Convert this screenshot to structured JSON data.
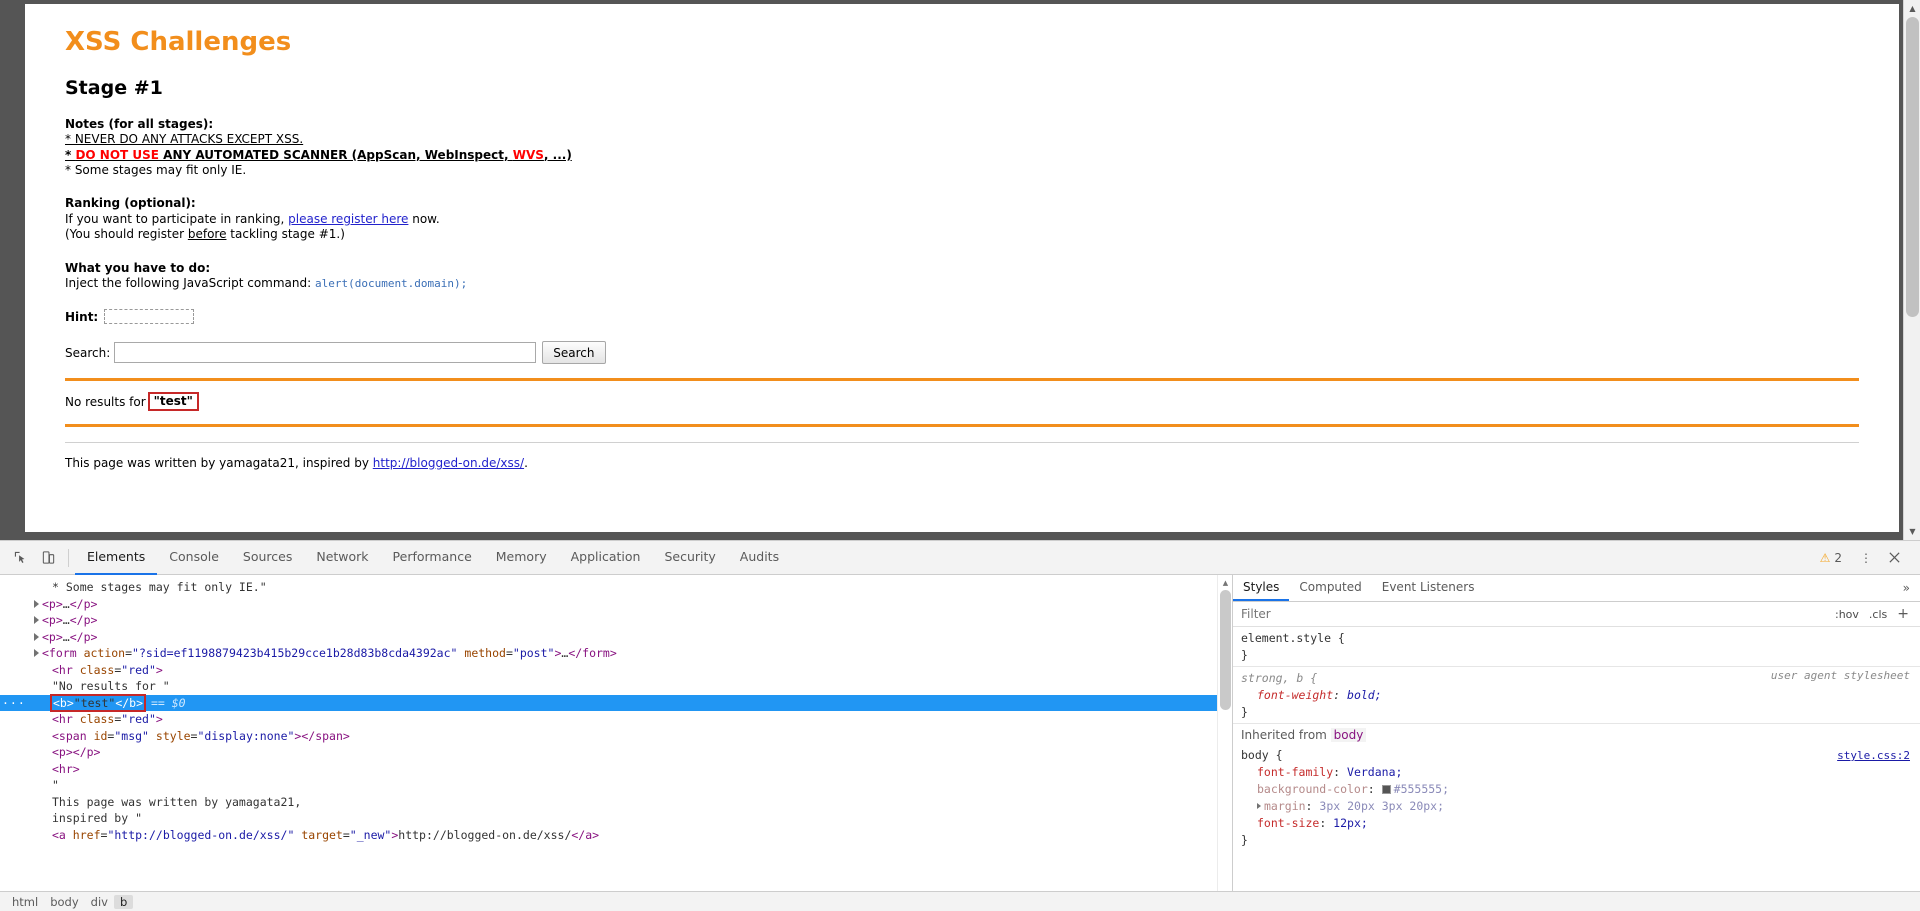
{
  "page": {
    "title": "XSS Challenges",
    "stage": "Stage #1",
    "notes_heading": "Notes (for all stages):",
    "note1": "* NEVER DO ANY ATTACKS EXCEPT XSS.",
    "note2_star": "* ",
    "note2_red": "DO NOT USE",
    "note2_rest": " ANY AUTOMATED SCANNER (AppScan, WebInspect, ",
    "note2_red2": "WVS",
    "note2_tail": ", ...)",
    "note3": "* Some stages may fit only IE.",
    "ranking_heading": "Ranking (optional):",
    "ranking_line1_pre": "If you want to participate in ranking, ",
    "ranking_link": "please register here",
    "ranking_line1_post": " now.",
    "ranking_line2_pre": "(You should register ",
    "ranking_line2_em": "before",
    "ranking_line2_post": " tackling stage #1.)",
    "todo_heading": "What you have to do:",
    "todo_text": "Inject the following JavaScript command: ",
    "todo_code": "alert(document.domain);",
    "hint_label": "Hint:",
    "hint_value": "",
    "search_label": "Search:",
    "search_value": "",
    "search_placeholder": "",
    "search_button": "Search",
    "result_prefix": "No results for ",
    "result_term": "\"test\"",
    "footer_pre": "This page was written by yamagata21, inspired by ",
    "footer_link": "http://blogged-on.de/xss/",
    "footer_post": "."
  },
  "devtools": {
    "tabs": [
      {
        "label": "Elements",
        "active": true
      },
      {
        "label": "Console",
        "active": false
      },
      {
        "label": "Sources",
        "active": false
      },
      {
        "label": "Network",
        "active": false
      },
      {
        "label": "Performance",
        "active": false
      },
      {
        "label": "Memory",
        "active": false
      },
      {
        "label": "Application",
        "active": false
      },
      {
        "label": "Security",
        "active": false
      },
      {
        "label": "Audits",
        "active": false
      }
    ],
    "warning_count": "2",
    "dom_lines": [
      {
        "id": "l0",
        "indent": 3,
        "twisty": false,
        "selected": false,
        "html": "<span class=\"txtc\">* Some stages may fit only IE.\"</span>"
      },
      {
        "id": "l1",
        "indent": 2,
        "twisty": true,
        "selected": false,
        "html": "<span class=\"tagc\">&lt;p&gt;</span><span class=\"punct\">…</span><span class=\"tagc\">&lt;/p&gt;</span>"
      },
      {
        "id": "l2",
        "indent": 2,
        "twisty": true,
        "selected": false,
        "html": "<span class=\"tagc\">&lt;p&gt;</span><span class=\"punct\">…</span><span class=\"tagc\">&lt;/p&gt;</span>"
      },
      {
        "id": "l3",
        "indent": 2,
        "twisty": true,
        "selected": false,
        "html": "<span class=\"tagc\">&lt;p&gt;</span><span class=\"punct\">…</span><span class=\"tagc\">&lt;/p&gt;</span>"
      },
      {
        "id": "l4",
        "indent": 2,
        "twisty": true,
        "selected": false,
        "html": "<span class=\"tagc\">&lt;form</span> <span class=\"attrn\">action</span><span class=\"punct\">=</span><span class=\"attrv\">\"?sid=ef1198879423b415b29cce1b28d83b8cda4392ac\"</span> <span class=\"attrn\">method</span><span class=\"punct\">=</span><span class=\"attrv\">\"post\"</span><span class=\"tagc\">&gt;</span><span class=\"punct\">…</span><span class=\"tagc\">&lt;/form&gt;</span>"
      },
      {
        "id": "l5",
        "indent": 3,
        "twisty": false,
        "selected": false,
        "html": "<span class=\"tagc\">&lt;hr</span> <span class=\"attrn\">class</span><span class=\"punct\">=</span><span class=\"attrv\">\"red\"</span><span class=\"tagc\">&gt;</span>"
      },
      {
        "id": "l6",
        "indent": 3,
        "twisty": false,
        "selected": false,
        "html": "<span class=\"txtc\">\"No results for \"</span>"
      },
      {
        "id": "l7",
        "indent": 3,
        "twisty": false,
        "selected": true,
        "html": "<span class=\"dom-hl\"><span class=\"tagc\">&lt;b&gt;</span><span class=\"txtc\">\"test\"</span><span class=\"tagc\">&lt;/b&gt;</span></span> <span class=\"dollar\">== $0</span>"
      },
      {
        "id": "l8",
        "indent": 3,
        "twisty": false,
        "selected": false,
        "html": "<span class=\"tagc\">&lt;hr</span> <span class=\"attrn\">class</span><span class=\"punct\">=</span><span class=\"attrv\">\"red\"</span><span class=\"tagc\">&gt;</span>"
      },
      {
        "id": "l9",
        "indent": 3,
        "twisty": false,
        "selected": false,
        "html": "<span class=\"tagc\">&lt;span</span> <span class=\"attrn\">id</span><span class=\"punct\">=</span><span class=\"attrv\">\"msg\"</span> <span class=\"attrn\">style</span><span class=\"punct\">=</span><span class=\"attrv\">\"display:none\"</span><span class=\"tagc\">&gt;&lt;/span&gt;</span>"
      },
      {
        "id": "l10",
        "indent": 3,
        "twisty": false,
        "selected": false,
        "html": "<span class=\"tagc\">&lt;p&gt;&lt;/p&gt;</span>"
      },
      {
        "id": "l11",
        "indent": 3,
        "twisty": false,
        "selected": false,
        "html": "<span class=\"tagc\">&lt;hr&gt;</span>"
      },
      {
        "id": "l12",
        "indent": 3,
        "twisty": false,
        "selected": false,
        "html": "<span class=\"txtc\">\"</span>"
      },
      {
        "id": "l13",
        "indent": 3,
        "twisty": false,
        "selected": false,
        "html": "<span class=\"txtc\">This page was written by yamagata21,</span>"
      },
      {
        "id": "l14",
        "indent": 3,
        "twisty": false,
        "selected": false,
        "html": "<span class=\"txtc\">inspired by \"</span>"
      },
      {
        "id": "l15",
        "indent": 3,
        "twisty": false,
        "selected": false,
        "html": "<span class=\"tagc\">&lt;a</span> <span class=\"attrn\">href</span><span class=\"punct\">=</span><span class=\"attrv\">\"http://blogged-on.de/xss/\"</span> <span class=\"attrn\">target</span><span class=\"punct\">=</span><span class=\"attrv\">\"_new\"</span><span class=\"tagc\">&gt;</span><span class=\"txtc\">http://blogged-on.de/xss/</span><span class=\"tagc\">&lt;/a&gt;</span>"
      }
    ],
    "styles": {
      "tabs": [
        {
          "label": "Styles",
          "active": true
        },
        {
          "label": "Computed",
          "active": false
        },
        {
          "label": "Event Listeners",
          "active": false
        }
      ],
      "more": "»",
      "filter_placeholder": "Filter",
      "hov": ":hov",
      "cls": ".cls",
      "plus": "+",
      "rules": [
        {
          "selector": "element.style {",
          "origin": "",
          "origin_is_link": false,
          "props": [],
          "close": "}"
        },
        {
          "selector": "strong, b {",
          "selector_italic": true,
          "origin": "user agent stylesheet",
          "origin_is_link": false,
          "props": [
            {
              "name": "font-weight",
              "value": "bold;",
              "dim": false,
              "italic": true
            }
          ],
          "close": "}"
        }
      ],
      "inherited_label": "Inherited from",
      "inherited_tag": "body",
      "body_rule": {
        "selector": "body {",
        "origin": "style.css:2",
        "origin_is_link": true,
        "props": [
          {
            "name": "font-family",
            "value": "Verdana;",
            "dim": false,
            "swatch": false,
            "triangle": false
          },
          {
            "name": "background-color",
            "value": "#555555;",
            "dim": true,
            "swatch": true,
            "swatch_color": "#555555",
            "triangle": false
          },
          {
            "name": "margin",
            "value": "3px 20px 3px 20px;",
            "dim": true,
            "swatch": false,
            "triangle": true
          },
          {
            "name": "font-size",
            "value": "12px;",
            "dim": false,
            "swatch": false,
            "triangle": false
          }
        ],
        "close": "}"
      }
    }
  },
  "breadcrumb": [
    {
      "label": "html",
      "active": false
    },
    {
      "label": "body",
      "active": false
    },
    {
      "label": "div",
      "active": false
    },
    {
      "label": "b",
      "active": true
    }
  ]
}
